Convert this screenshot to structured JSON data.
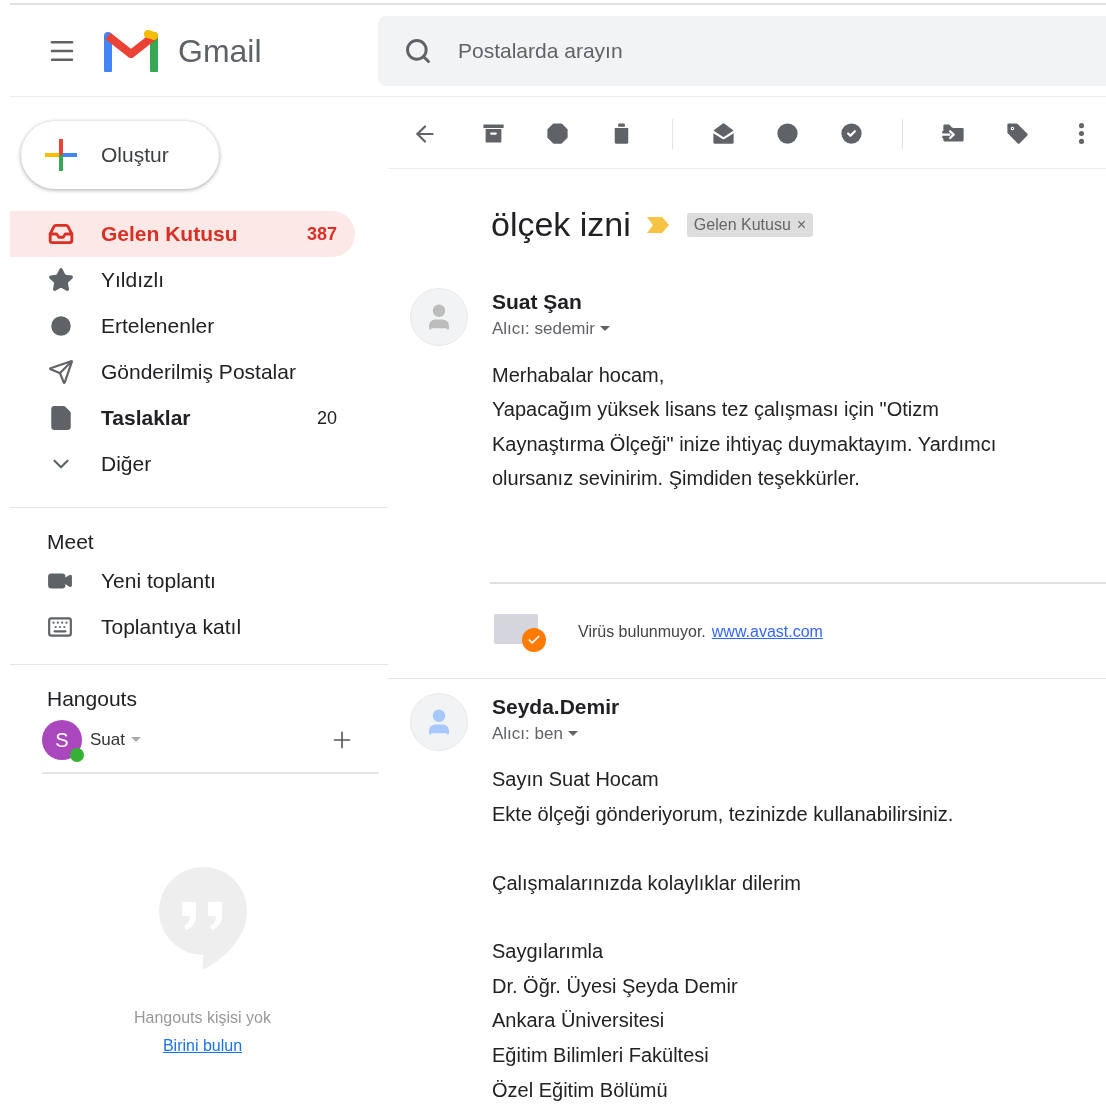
{
  "header": {
    "app_name": "Gmail",
    "search": {
      "placeholder": "Postalarda arayın"
    }
  },
  "compose": {
    "label": "Oluştur"
  },
  "nav": [
    {
      "label": "Gelen Kutusu",
      "count": "387",
      "selected": true,
      "unread": true
    },
    {
      "label": "Yıldızlı",
      "selected": false,
      "unread": false
    },
    {
      "label": "Ertelenenler",
      "selected": false,
      "unread": false
    },
    {
      "label": "Gönderilmiş Postalar",
      "selected": false,
      "unread": false
    },
    {
      "label": "Taslaklar",
      "count": "20",
      "selected": false,
      "unread": true
    },
    {
      "label": "Diğer",
      "selected": false,
      "unread": false
    }
  ],
  "meet": {
    "title": "Meet",
    "items": [
      "Yeni toplantı",
      "Toplantıya katıl"
    ]
  },
  "hangouts": {
    "title": "Hangouts",
    "user": {
      "initial": "S",
      "name": "Suat",
      "color": "#ab47bc",
      "online": true
    },
    "empty_text": "Hangouts kişisi yok",
    "find_link": "Birini bulun"
  },
  "thread": {
    "subject": "ölçek izni",
    "important": true,
    "labels": [
      {
        "text": "Gelen Kutusu",
        "close": "×"
      }
    ],
    "messages": [
      {
        "sender": "Suat Şan",
        "recipient": "Alıcı: sedemir",
        "color": "#bdbdbd",
        "paragraphs": [
          [
            "Merhabalar hocam,",
            "Yapacağım yüksek lisans tez çalışması için \"Otizm",
            "Kaynaştırma Ölçeği\" inize ihtiyaç duymaktayım. Yardımcı",
            "olursanız sevinirim. Şimdiden teşekkürler."
          ]
        ],
        "signature": {
          "text": "Virüs bulunmuyor.",
          "link": "www.avast.com"
        }
      },
      {
        "sender": "Seyda.Demir",
        "recipient": "Alıcı: ben",
        "color": "#a8c7fa",
        "paragraphs": [
          [
            "Sayın Suat Hocam",
            "Ekte ölçeği gönderiyorum, tezinizde kullanabilirsiniz."
          ],
          [
            "Çalışmalarınızda kolaylıklar dilerim"
          ],
          [
            "Saygılarımla",
            "Dr. Öğr. Üyesi Şeyda Demir",
            "Ankara Üniversitesi",
            "Eğitim Bilimleri Fakültesi",
            "Özel Eğitim Bölümü"
          ]
        ]
      }
    ]
  }
}
